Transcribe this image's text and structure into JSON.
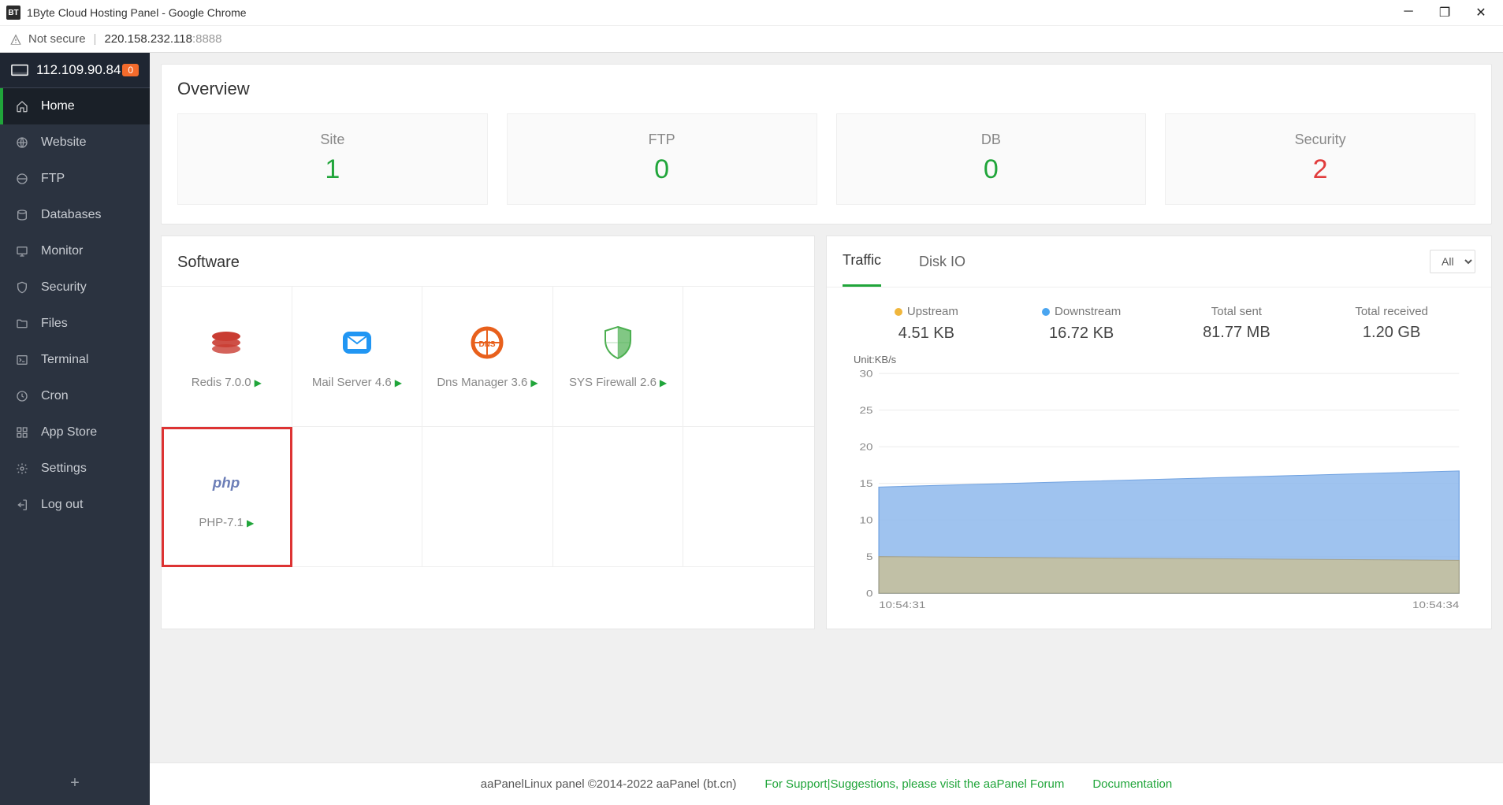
{
  "browser": {
    "title": "1Byte Cloud Hosting Panel - Google Chrome",
    "favicon": "BT",
    "not_secure": "Not secure",
    "url_main": "220.158.232.118",
    "url_port": ":8888"
  },
  "sidebar": {
    "ip": "112.109.90.84",
    "badge": "0",
    "items": [
      {
        "label": "Home",
        "icon": "home-icon"
      },
      {
        "label": "Website",
        "icon": "globe-icon"
      },
      {
        "label": "FTP",
        "icon": "ftp-icon"
      },
      {
        "label": "Databases",
        "icon": "database-icon"
      },
      {
        "label": "Monitor",
        "icon": "monitor-icon"
      },
      {
        "label": "Security",
        "icon": "shield-icon"
      },
      {
        "label": "Files",
        "icon": "folder-icon"
      },
      {
        "label": "Terminal",
        "icon": "terminal-icon"
      },
      {
        "label": "Cron",
        "icon": "clock-icon"
      },
      {
        "label": "App Store",
        "icon": "grid-icon"
      },
      {
        "label": "Settings",
        "icon": "gear-icon"
      },
      {
        "label": "Log out",
        "icon": "logout-icon"
      }
    ]
  },
  "overview": {
    "title": "Overview",
    "stats": [
      {
        "label": "Site",
        "value": "1",
        "color": "green"
      },
      {
        "label": "FTP",
        "value": "0",
        "color": "green"
      },
      {
        "label": "DB",
        "value": "0",
        "color": "green"
      },
      {
        "label": "Security",
        "value": "2",
        "color": "red"
      }
    ]
  },
  "software": {
    "title": "Software",
    "items": [
      {
        "name": "Redis 7.0.0",
        "icon": "redis-icon"
      },
      {
        "name": "Mail Server 4.6",
        "icon": "mail-icon"
      },
      {
        "name": "Dns Manager 3.6",
        "icon": "dns-icon"
      },
      {
        "name": "SYS Firewall 2.6",
        "icon": "firewall-icon"
      },
      {
        "name": "PHP-7.1",
        "icon": "php-icon",
        "highlight": true
      }
    ]
  },
  "traffic": {
    "tabs": [
      {
        "label": "Traffic",
        "active": true
      },
      {
        "label": "Disk IO",
        "active": false
      }
    ],
    "filter": "All",
    "stats": [
      {
        "label": "Upstream",
        "value": "4.51 KB",
        "dot": "y"
      },
      {
        "label": "Downstream",
        "value": "16.72 KB",
        "dot": "b"
      },
      {
        "label": "Total sent",
        "value": "81.77 MB"
      },
      {
        "label": "Total received",
        "value": "1.20 GB"
      }
    ],
    "unit_label": "Unit:KB/s"
  },
  "footer": {
    "copyright": "aaPanelLinux panel ©2014-2022 aaPanel (bt.cn)",
    "support_link": "For Support|Suggestions, please visit the aaPanel Forum",
    "docs_link": "Documentation"
  },
  "chart_data": {
    "type": "area",
    "title": "",
    "xlabel": "",
    "ylabel": "Unit:KB/s",
    "ylim": [
      0,
      30
    ],
    "yticks": [
      0,
      5,
      10,
      15,
      20,
      25,
      30
    ],
    "x": [
      "10:54:31",
      "10:54:34"
    ],
    "series": [
      {
        "name": "Downstream",
        "values": [
          14.5,
          16.7
        ],
        "color": "#6fa8e8"
      },
      {
        "name": "Upstream",
        "values": [
          5.0,
          4.5
        ],
        "color": "#c8c09a"
      }
    ]
  }
}
